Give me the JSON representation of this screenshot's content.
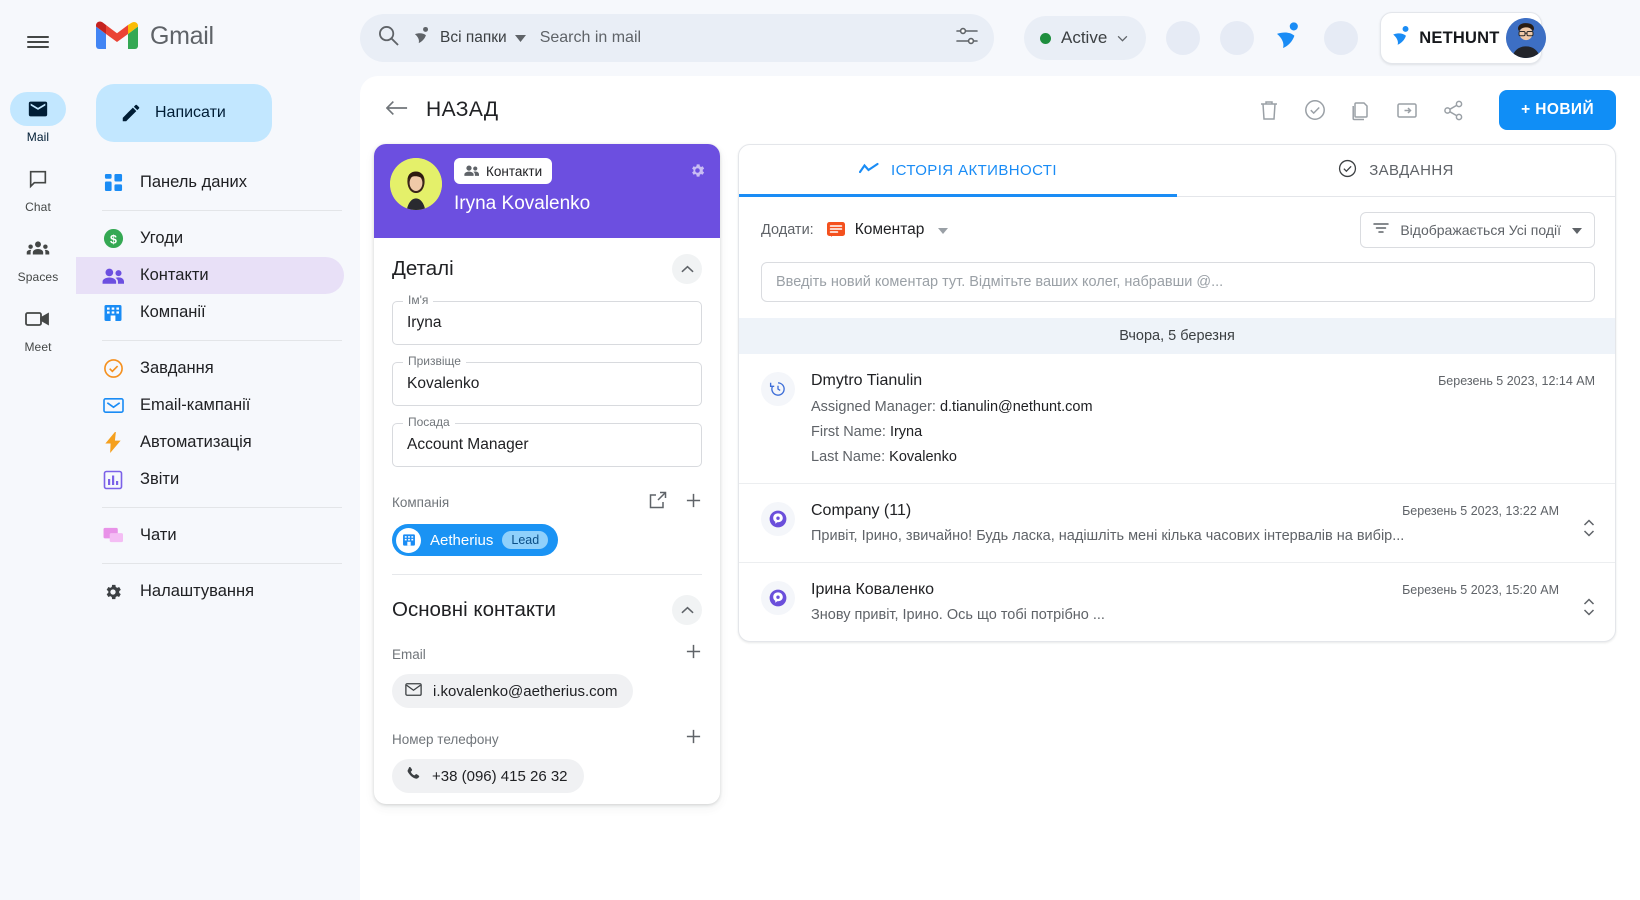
{
  "rail": {
    "menu_icon": "hamburger-icon",
    "items": [
      {
        "label": "Mail",
        "icon": "mail-icon",
        "active": true
      },
      {
        "label": "Chat",
        "icon": "chat-icon",
        "active": false
      },
      {
        "label": "Spaces",
        "icon": "spaces-icon",
        "active": false
      },
      {
        "label": "Meet",
        "icon": "meet-icon",
        "active": false
      }
    ]
  },
  "brand": {
    "name": "Gmail",
    "logo_icon": "gmail-logo-icon"
  },
  "compose": {
    "label": "Написати",
    "icon": "pencil-icon"
  },
  "sidebar": {
    "groups": [
      {
        "items": [
          {
            "label": "Панель даних",
            "icon": "dashboard-icon",
            "active": false
          }
        ]
      },
      {
        "items": [
          {
            "label": "Угоди",
            "icon": "deals-dollar-icon",
            "active": false
          },
          {
            "label": "Контакти",
            "icon": "contacts-people-icon",
            "active": true
          },
          {
            "label": "Компанії",
            "icon": "companies-building-icon",
            "active": false
          }
        ]
      },
      {
        "items": [
          {
            "label": "Завдання",
            "icon": "tasks-check-icon",
            "active": false
          },
          {
            "label": "Email-кампанії",
            "icon": "email-campaign-icon",
            "active": false
          },
          {
            "label": "Автоматизація",
            "icon": "automation-bolt-icon",
            "active": false
          },
          {
            "label": "Звіти",
            "icon": "reports-chart-icon",
            "active": false
          }
        ]
      },
      {
        "items": [
          {
            "label": "Чати",
            "icon": "chats-bubble-icon",
            "active": false
          }
        ]
      },
      {
        "items": [
          {
            "label": "Налаштування",
            "icon": "settings-gear-icon",
            "active": false
          }
        ]
      }
    ]
  },
  "search": {
    "search_icon": "search-icon",
    "folder_icon": "nethunt-mark-icon",
    "folder_label": "Всі папки",
    "folder_caret": "chevron-down-icon",
    "placeholder": "Search in mail",
    "tune_icon": "tune-sliders-icon"
  },
  "status": {
    "label": "Active",
    "color": "#1e8e3e",
    "caret": "chevron-down-icon"
  },
  "nethunt_badge": {
    "word_net": "N",
    "word_net_rest": "ET",
    "word_hunt": "H",
    "word_hunt_rest": "UNT",
    "full": "NETHUNT",
    "icon": "nethunt-mark-icon"
  },
  "record_header": {
    "back_icon": "arrow-left-icon",
    "back_label": "НАЗАД",
    "actions": [
      {
        "name": "delete-icon"
      },
      {
        "name": "task-check-icon"
      },
      {
        "name": "copy-icon"
      },
      {
        "name": "move-folder-icon"
      },
      {
        "name": "share-icon"
      }
    ],
    "new_button": "+ НОВИЙ"
  },
  "contact_card": {
    "folder_chip": "Контакти",
    "folder_chip_icon": "contacts-people-icon",
    "name": "Iryna Kovalenko",
    "gear_icon": "gear-icon",
    "details_title": "Деталі",
    "collapse_icon": "chevron-up-icon",
    "fields": [
      {
        "label": "Ім'я",
        "value": "Iryna"
      },
      {
        "label": "Призвіще",
        "value": "Kovalenko"
      },
      {
        "label": "Посада",
        "value": "Account Manager"
      }
    ],
    "company_label": "Компанія",
    "company_open_icon": "open-in-new-icon",
    "company_add_icon": "plus-icon",
    "company": {
      "name": "Aetherius",
      "tag": "Lead",
      "icon": "building-icon"
    },
    "contacts_title": "Основні контакти",
    "email_label": "Email",
    "email_value": "i.kovalenko@aetherius.com",
    "email_icon": "envelope-icon",
    "email_add_icon": "plus-icon",
    "phone_label": "Номер телефону",
    "phone_value": "+38 (096) 415 26 32",
    "phone_icon": "phone-icon",
    "phone_add_icon": "plus-icon"
  },
  "activity": {
    "tabs": [
      {
        "label": "ІСТОРІЯ АКТИВНОСТІ",
        "icon": "activity-line-icon",
        "active": true
      },
      {
        "label": "ЗАВДАННЯ",
        "icon": "task-check-icon",
        "active": false
      }
    ],
    "add_label": "Додати:",
    "add_value": "Коментар",
    "add_icon": "comment-icon",
    "add_caret": "chevron-down-icon",
    "filter_icon": "filter-icon",
    "filter_text": "Відображається Усі події",
    "filter_caret": "chevron-down-icon",
    "comment_placeholder": "Введіть новий коментар тут. Відмітьте ваших колег, набравши @...",
    "day_separator": "Вчора, 5 березня",
    "events": [
      {
        "icon": "history-clock-icon",
        "icon_color": "#3f6fd8",
        "name": "Dmytro Tianulin",
        "time": "Березень 5 2023, 12:14 AM",
        "lines": [
          {
            "label": "Assigned Manager: ",
            "value": "d.tianulin@nethunt.com"
          },
          {
            "label": "First Name: ",
            "value": "Iryna"
          },
          {
            "label": "Last Name: ",
            "value": "Kovalenko"
          }
        ],
        "text": "",
        "expandable": false
      },
      {
        "icon": "viber-icon",
        "icon_color": "#6b4fdb",
        "name": "Company (11)",
        "time": "Березень 5 2023, 13:22 AM",
        "lines": [],
        "text": "Привіт, Ірино, звичайно! Будь ласка, надішліть мені кілька часових інтервалів на вибір...",
        "expandable": true,
        "expand_icon": "expand-vertical-icon"
      },
      {
        "icon": "viber-icon",
        "icon_color": "#6b4fdb",
        "name": "Ірина Коваленко",
        "time": "Березень 5 2023, 15:20 AM",
        "lines": [],
        "text": "Знову привіт, Ірино. Ось що тобі потрібно ...",
        "expandable": true,
        "expand_icon": "expand-vertical-icon"
      }
    ]
  }
}
